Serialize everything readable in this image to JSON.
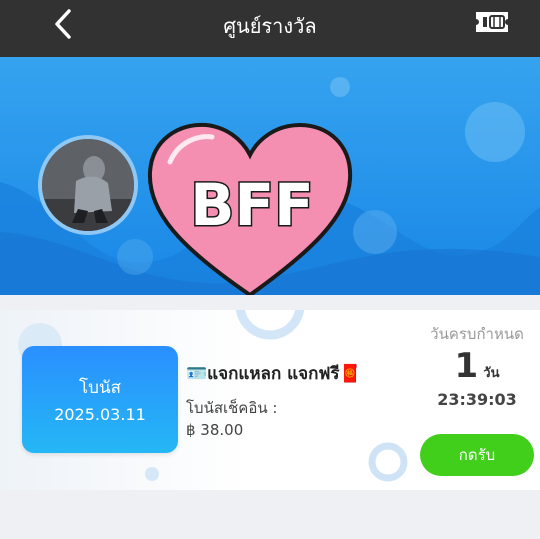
{
  "header": {
    "title": "ศูนย์รางวัล",
    "back_icon": "chevron-left-icon",
    "ticket_icon": "ticket-icon"
  },
  "banner": {
    "heart_text": "BFF",
    "colors": {
      "heart": "#f48fb1",
      "banner": "#1f8fe8"
    }
  },
  "reward": {
    "bonus_label": "โบนัส",
    "bonus_date": "2025.03.11",
    "promo_name": "🪪แจกแหลก แจกฟรี🧧",
    "promo_sub": "โบนัสเช็คอิน :",
    "amount": "฿ 38.00",
    "deadline_label": "วันครบกำหนด",
    "days_value": "1",
    "days_unit": "วัน",
    "time_left": "23:39:03",
    "claim_button": "กดรับ",
    "colors": {
      "claim": "#41cf1c",
      "bonus_box": "#2a8fff"
    }
  }
}
